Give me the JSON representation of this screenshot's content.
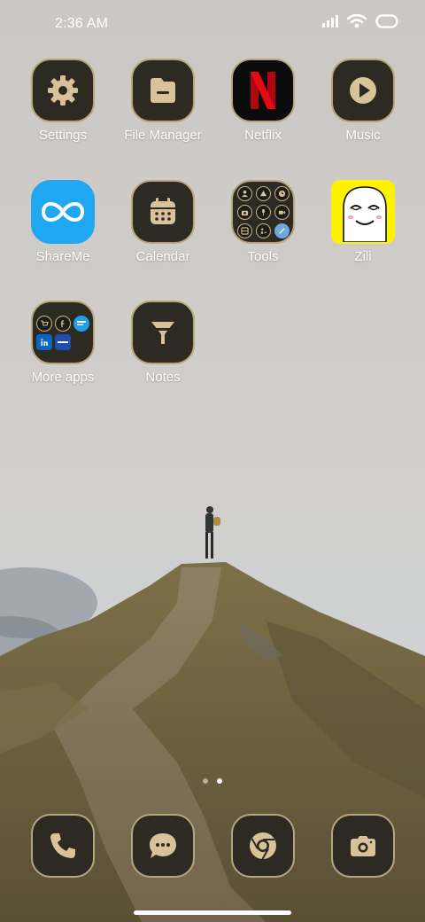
{
  "status_bar": {
    "time": "2:36 AM",
    "icons": [
      "signal-icon",
      "wifi-icon",
      "battery-icon"
    ]
  },
  "home": {
    "apps": [
      {
        "label": "Settings",
        "icon": "gear-icon"
      },
      {
        "label": "File Manager",
        "icon": "folder-icon"
      },
      {
        "label": "Netflix",
        "icon": "netflix-logo-icon"
      },
      {
        "label": "Music",
        "icon": "play-icon"
      },
      {
        "label": "ShareMe",
        "icon": "infinity-icon"
      },
      {
        "label": "Calendar",
        "icon": "calendar-icon"
      },
      {
        "label": "Tools",
        "icon": "tools-folder-icon"
      },
      {
        "label": "Zili",
        "icon": "zili-face-icon"
      },
      {
        "label": "More apps",
        "icon": "apps-folder-icon"
      },
      {
        "label": "Notes",
        "icon": "funnel-icon"
      }
    ]
  },
  "page_indicator": {
    "pages": 2,
    "active_page": 2
  },
  "dock": [
    {
      "icon": "phone-icon"
    },
    {
      "icon": "message-icon"
    },
    {
      "icon": "chrome-icon"
    },
    {
      "icon": "camera-icon"
    }
  ],
  "colors": {
    "icon_background": "#2c2a22",
    "icon_border": "#b9a57c",
    "icon_glyph": "#d9c29a",
    "netflix_red": "#e50914",
    "shareme_blue": "#1fa7f2",
    "zili_yellow": "#fff200"
  }
}
